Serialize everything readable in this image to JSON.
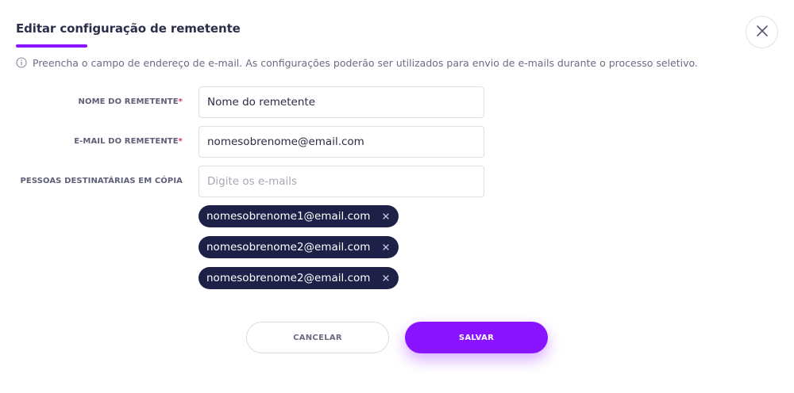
{
  "modal": {
    "title": "Editar configuração de remetente",
    "info_text": "Preencha o campo de endereço de e-mail. As configurações poderão ser utilizados para envio de e-mails durante o processo seletivo."
  },
  "form": {
    "sender_name": {
      "label": "NOME DO REMETENTE",
      "required_mark": "*",
      "value": "Nome do remetente"
    },
    "sender_email": {
      "label": "E-MAIL DO REMETENTE",
      "required_mark": "*",
      "value": "nomesobrenome@email.com"
    },
    "cc_recipients": {
      "label": "PESSOAS DESTINATÁRIAS EM CÓPIA",
      "placeholder": "Digite os e-mails",
      "chips": [
        "nomesobrenome1@email.com",
        "nomesobrenome2@email.com",
        "nomesobrenome2@email.com"
      ]
    }
  },
  "actions": {
    "cancel_label": "CANCELAR",
    "save_label": "SALVAR"
  },
  "colors": {
    "accent": "#8a14ff",
    "chip_background": "#1e2147",
    "required": "#e0306a"
  },
  "icons": {
    "close": "close-icon",
    "info": "info-icon",
    "chip_remove": "remove-chip-icon"
  }
}
